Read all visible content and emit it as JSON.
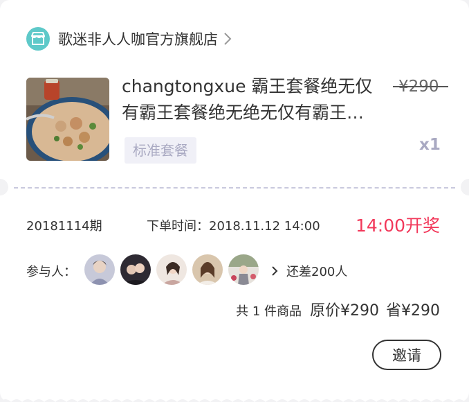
{
  "store": {
    "name": "歌迷非人人咖官方旗舰店",
    "icon": "store-icon",
    "accent": "#5ec9c9"
  },
  "product": {
    "title": "changtongxue 霸王套餐绝无仅有霸王套餐绝无绝无仅有霸王套餐绝无仅有",
    "original_price": "¥290",
    "tag": "标准套餐",
    "quantity": "x1"
  },
  "lottery": {
    "period": "20181114期",
    "order_time_label": "下单时间：",
    "order_time": "2018.11.12 14:00",
    "draw_time": "14:00开奖",
    "draw_color": "#f2385a"
  },
  "participants": {
    "label": "参与人：",
    "avatar_count": 5,
    "more_label": "还差200人"
  },
  "summary": {
    "count": "共 1 件商品",
    "price": "原价¥290",
    "save": "省¥290"
  },
  "actions": {
    "invite_label": "邀请"
  }
}
